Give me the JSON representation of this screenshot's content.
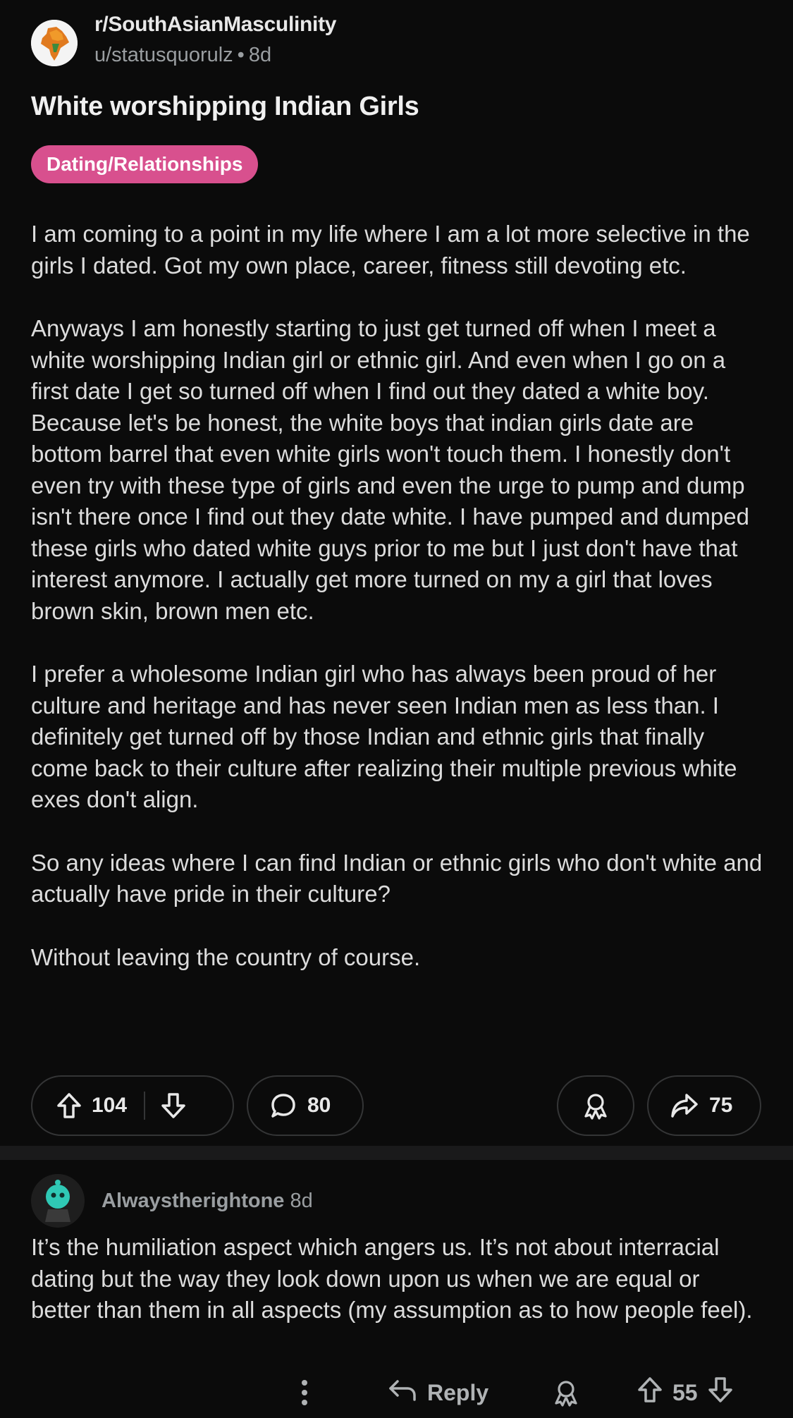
{
  "post": {
    "subreddit": "r/SouthAsianMasculinity",
    "author": "u/statusquorulz",
    "separator": "•",
    "age": "8d",
    "title": "White worshipping Indian Girls",
    "flair": "Dating/Relationships",
    "paragraphs": [
      "I am coming to a point in my life where I am a lot more selective in the girls I dated. Got my own place, career, fitness still devoting etc.",
      "Anyways I am honestly starting to just get turned off when I meet a white worshipping Indian girl or ethnic girl. And even when I go on a first date I get so turned off when I find out they dated a white boy. Because let's be honest, the white boys that indian girls date are bottom barrel that even white girls won't touch them. I honestly don't even try with these type of girls and even the urge to pump and dump isn't there once I find out they date white. I have pumped and dumped these girls who dated white guys prior to me but I just don't have that interest anymore. I actually get more turned on my a girl that loves brown skin, brown men etc.",
      "I prefer a wholesome Indian girl who has always been proud of her culture and heritage and has never seen Indian men as less than. I definitely get turned off by those Indian and ethnic girls that finally come back to their culture after realizing their multiple previous white exes don't align.",
      "So any ideas where I can find Indian or ethnic girls who don't white and actually have pride in their culture?",
      "Without leaving the country of course."
    ],
    "upvotes": "104",
    "comments": "80",
    "shares": "75",
    "flair_color": "#d8508e"
  },
  "comment": {
    "author": "Alwaystherightone",
    "age": "8d",
    "text": "It’s the humiliation aspect which angers us. It’s not about interracial dating but the way they look down upon us when we are equal or better than them in all aspects (my assumption as to how people feel).",
    "reply_label": "Reply",
    "upvotes": "55"
  },
  "icons": {
    "upvote": "arrow-up-icon",
    "downvote": "arrow-down-icon",
    "comment": "speech-bubble-icon",
    "award": "award-icon",
    "share": "share-arrow-icon",
    "more": "vertical-dots-icon",
    "reply": "reply-arrow-icon"
  }
}
